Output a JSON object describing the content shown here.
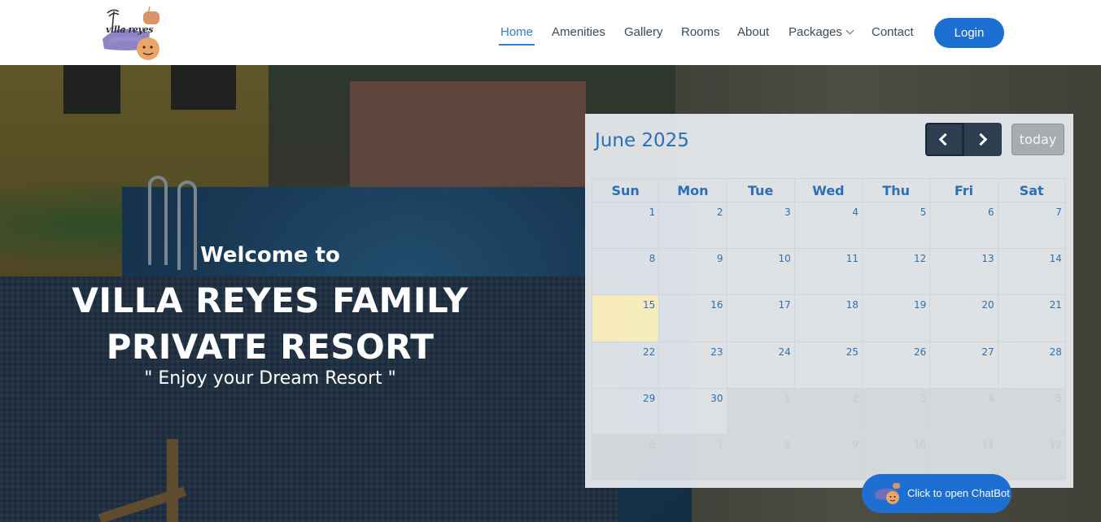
{
  "logo": {
    "text": "villa reyes",
    "icon": "villa-reyes-logo"
  },
  "nav": {
    "items": [
      {
        "label": "Home",
        "active": true
      },
      {
        "label": "Amenities"
      },
      {
        "label": "Gallery"
      },
      {
        "label": "Rooms"
      },
      {
        "label": "About"
      },
      {
        "label": "Packages",
        "icon": "chevron-down-icon"
      },
      {
        "label": "Contact"
      }
    ],
    "login_label": "Login",
    "accent_color": "#1d6fd1"
  },
  "hero": {
    "welcome": "Welcome to",
    "title_line1": "VILLA REYES FAMILY",
    "title_line2": "PRIVATE RESORT",
    "tagline": "\" Enjoy your Dream Resort \""
  },
  "calendar": {
    "title": "June 2025",
    "prev_icon": "chevron-left-icon",
    "next_icon": "chevron-right-icon",
    "today_label": "today",
    "weekdays": [
      "Sun",
      "Mon",
      "Tue",
      "Wed",
      "Thu",
      "Fri",
      "Sat"
    ],
    "today_date": "15",
    "weeks": [
      [
        "1",
        "2",
        "3",
        "4",
        "5",
        "6",
        "7"
      ],
      [
        "8",
        "9",
        "10",
        "11",
        "12",
        "13",
        "14"
      ],
      [
        "15",
        "16",
        "17",
        "18",
        "19",
        "20",
        "21"
      ],
      [
        "22",
        "23",
        "24",
        "25",
        "26",
        "27",
        "28"
      ],
      [
        "29",
        "30",
        "1",
        "2",
        "3",
        "4",
        "5"
      ],
      [
        "6",
        "7",
        "8",
        "9",
        "10",
        "11",
        "12"
      ]
    ]
  },
  "chatbot": {
    "label": "Click to open ChatBot",
    "icon": "chatbot-avatar-icon"
  }
}
